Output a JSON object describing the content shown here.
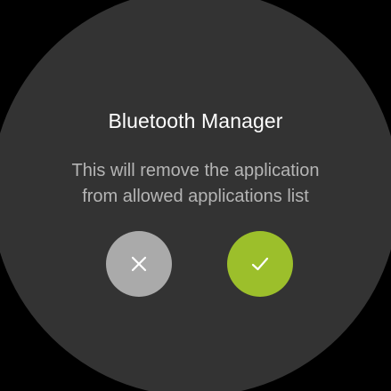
{
  "dialog": {
    "title": "Bluetooth Manager",
    "message_lines": [
      "This will remove the application",
      "from allowed applications list"
    ]
  },
  "actions": {
    "cancel": {
      "icon": "close-icon",
      "color": "#aaaaaa"
    },
    "confirm": {
      "icon": "check-icon",
      "color": "#9cbf2b"
    }
  },
  "colors": {
    "background": "#000000",
    "watch_face": "#333333",
    "title_text": "#ffffff",
    "message_text": "#b5b5b5"
  }
}
